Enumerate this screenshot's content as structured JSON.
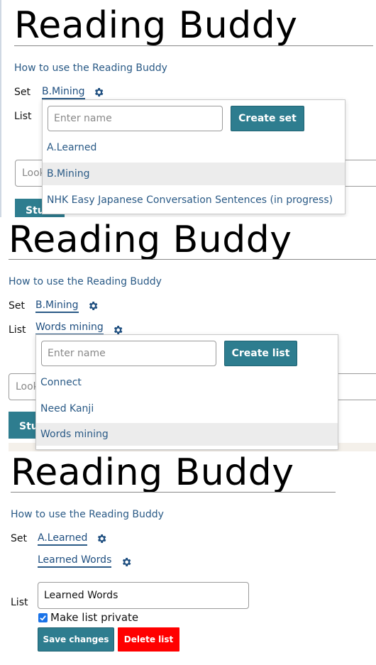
{
  "app": {
    "title": "Reading Buddy",
    "help_link": "How to use the Reading Buddy"
  },
  "labels": {
    "set": "Set",
    "list": "List"
  },
  "panel1": {
    "selected_set": "B.Mining",
    "dropdown": {
      "placeholder": "Enter name",
      "create_label": "Create set",
      "items": [
        {
          "label": "A.Learned"
        },
        {
          "label": "B.Mining",
          "active": true
        },
        {
          "label": "NHK Easy Japanese Conversation Sentences (in progress)"
        }
      ]
    },
    "lookup_partial": "Look",
    "study_partial": "Stu"
  },
  "panel2": {
    "selected_set": "B.Mining",
    "selected_list": "Words mining",
    "dropdown": {
      "placeholder": "Enter name",
      "create_label": "Create list",
      "items": [
        {
          "label": "Connect"
        },
        {
          "label": "Need Kanji"
        },
        {
          "label": "Words mining",
          "active": true
        }
      ]
    },
    "lookup_partial": "Look",
    "study_partial": "Stu"
  },
  "panel3": {
    "selected_set": "A.Learned",
    "selected_list": "Learned Words",
    "list_name_value": "Learned Words",
    "private_checkbox": {
      "label": "Make list private",
      "checked": true
    },
    "save_label": "Save changes",
    "delete_label": "Delete list"
  },
  "colors": {
    "accent": "#2e7d8f",
    "link": "#2a5a86",
    "danger": "#ff0000"
  }
}
